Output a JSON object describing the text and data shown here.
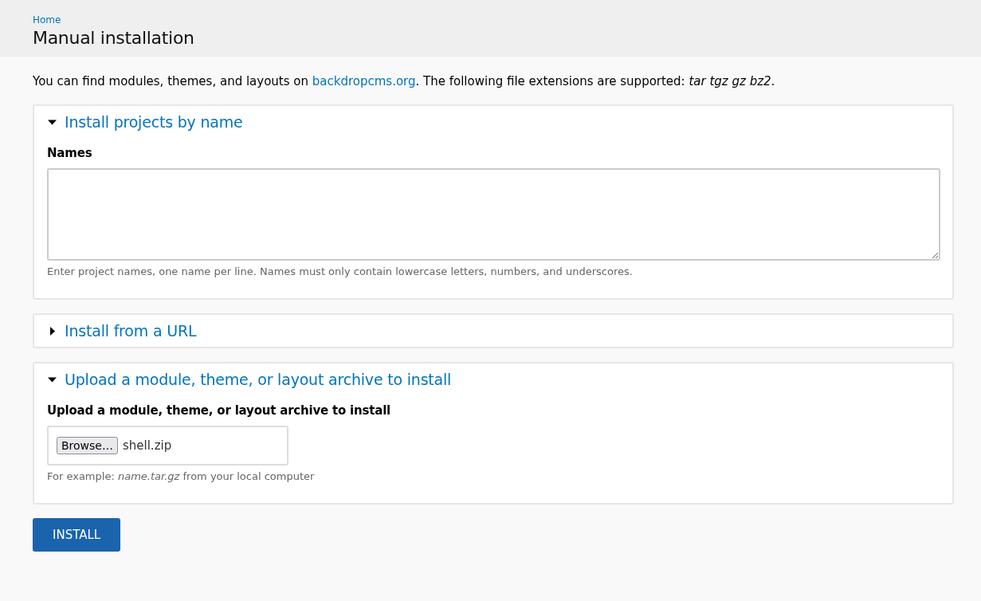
{
  "breadcrumb": {
    "label": "Home"
  },
  "title": "Manual installation",
  "intro": {
    "before": "You can find modules, themes, and layouts on",
    "link": "backdropcms.org",
    "after": ". The following file extensions are supported: *tar tgz gz bz2*."
  },
  "sections": [
    {
      "title": "Install projects by name",
      "expanded": true,
      "kind": "textarea",
      "label": "Names",
      "description": "Enter project names, one name per line. Names must only contain lowercase letters, numbers, and underscores."
    },
    {
      "title": "Install from a URL",
      "expanded": false
    },
    {
      "title": "Upload a module, theme, or layout archive to install",
      "expanded": true,
      "kind": "file",
      "label": "Upload a module, theme, or layout archive to install",
      "button": "Browse…",
      "file": "shell.zip",
      "description": "For example: *name.tar.gz* from your local computer"
    }
  ],
  "submit": "INSTALL"
}
